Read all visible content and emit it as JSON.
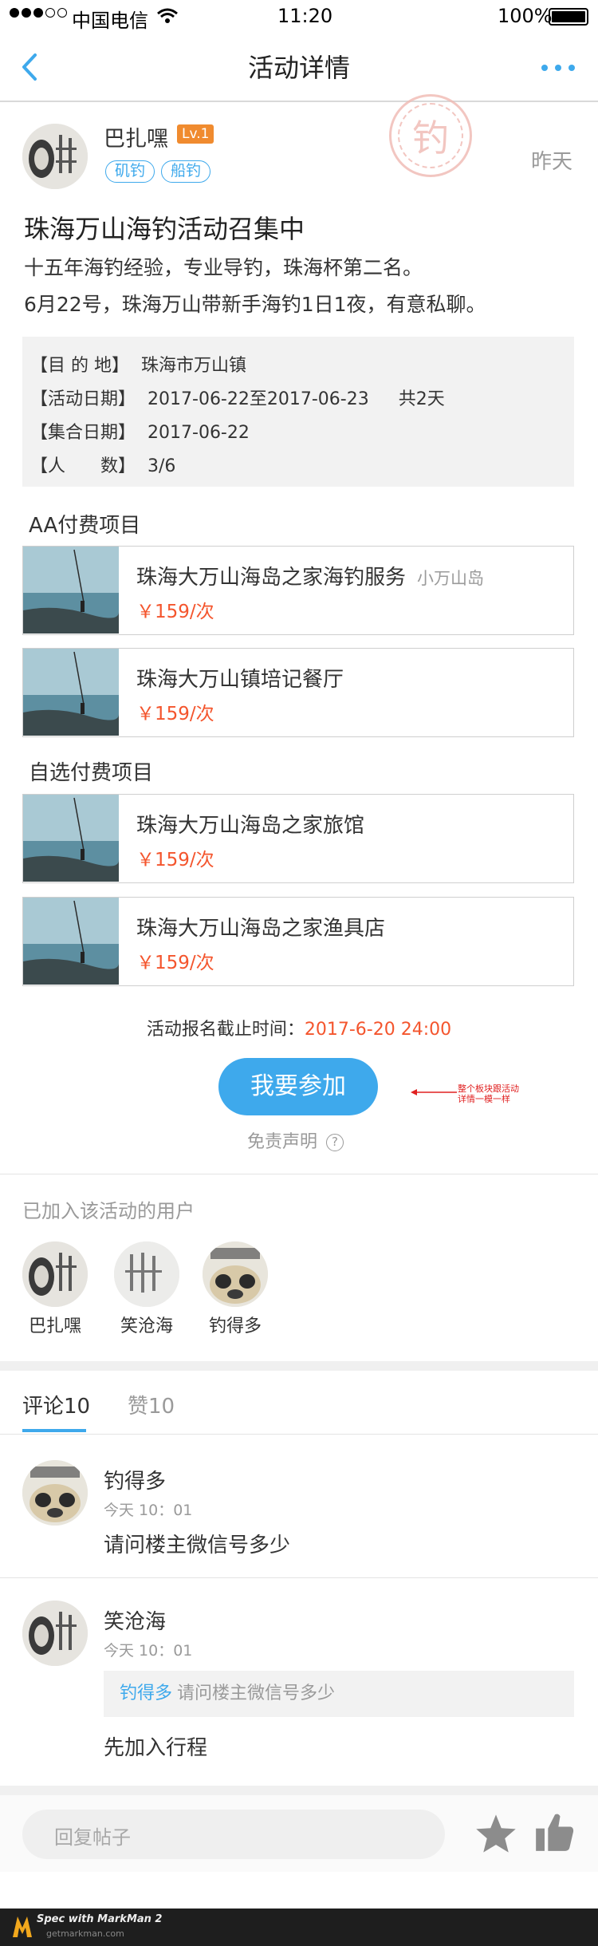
{
  "status_bar": {
    "carrier": "中国电信",
    "time": "11:20",
    "battery": "100%"
  },
  "nav": {
    "title": "活动详情",
    "more_icon": "more-dots-icon",
    "back_icon": "chevron-left-icon"
  },
  "post": {
    "author": "巴扎嘿",
    "level": "Lv.1",
    "tags": [
      "矶钓",
      "船钓"
    ],
    "time": "昨天",
    "stamp_char": "钓",
    "title": "珠海万山海钓活动召集中",
    "body_line1": "十五年海钓经验，专业导钓，珠海杯第二名。",
    "body_line2": "6月22号，珠海万山带新手海钓1日1夜，有意私聊。"
  },
  "info": {
    "dest_label": "【目 的 地】",
    "dest_value": "珠海市万山镇",
    "date_label": "【活动日期】",
    "date_value": "2017-06-22至2017-06-23",
    "date_total": "共2天",
    "gather_label": "【集合日期】",
    "gather_value": "2017-06-22",
    "people_label": "【人　　数】",
    "people_value": "3/6"
  },
  "aa_section": {
    "title": "AA付费项目",
    "items": [
      {
        "name": "珠海大万山海岛之家海钓服务",
        "location": "小万山岛",
        "price": "￥159/次"
      },
      {
        "name": "珠海大万山镇培记餐厅",
        "location": "",
        "price": "￥159/次"
      }
    ]
  },
  "optional_section": {
    "title": "自选付费项目",
    "items": [
      {
        "name": "珠海大万山海岛之家旅馆",
        "price": "￥159/次"
      },
      {
        "name": "珠海大万山海岛之家渔具店",
        "price": "￥159/次"
      }
    ]
  },
  "deadline": {
    "label": "活动报名截止时间：",
    "value": "2017-6-20 24:00"
  },
  "join_button": "我要参加",
  "annotation": {
    "line1": "整个板块跟活动",
    "line2": "详情一模一样"
  },
  "disclaimer": "免责声明",
  "members": {
    "title": "已加入该活动的用户",
    "users": [
      "巴扎嘿",
      "笑沧海",
      "钓得多"
    ]
  },
  "tabs": {
    "comments": "评论10",
    "likes": "赞10"
  },
  "comments": [
    {
      "user": "钓得多",
      "time": "今天 10：01",
      "text": "请问楼主微信号多少"
    },
    {
      "user": "笑沧海",
      "time": "今天 10：01",
      "quote_user": "钓得多",
      "quote_text": "请问楼主微信号多少",
      "text": "先加入行程"
    }
  ],
  "reply": {
    "placeholder": "回复帖子",
    "star_icon": "star-icon",
    "like_icon": "thumbs-up-icon"
  },
  "footer": {
    "brand": "Spec with MarkMan 2",
    "url": "getmarkman.com"
  },
  "colors": {
    "accent": "#3ea9ec",
    "price": "#f4552d",
    "level_badge": "#f08b2f",
    "button": "#3ea9ec"
  }
}
